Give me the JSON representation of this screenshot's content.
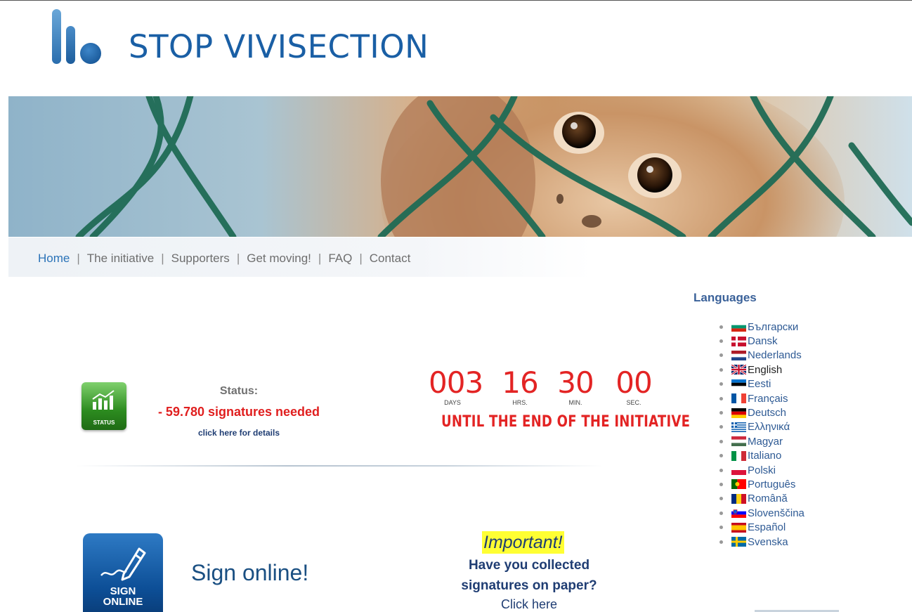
{
  "header": {
    "site_title": "STOP VIVISECTION"
  },
  "nav": {
    "items": [
      {
        "label": "Home",
        "active": true
      },
      {
        "label": "The initiative",
        "active": false
      },
      {
        "label": "Supporters",
        "active": false
      },
      {
        "label": "Get moving!",
        "active": false
      },
      {
        "label": "FAQ",
        "active": false
      },
      {
        "label": "Contact",
        "active": false
      }
    ],
    "separator": "|"
  },
  "status": {
    "icon_label": "STATUS",
    "title": "Status:",
    "needed": "- 59.780 signatures needed",
    "details_link": "click here for details"
  },
  "countdown": {
    "units": [
      {
        "value": "003",
        "label": "DAYS"
      },
      {
        "value": "16",
        "label": "HRS."
      },
      {
        "value": "30",
        "label": "MIN."
      },
      {
        "value": "00",
        "label": "SEC."
      }
    ],
    "caption": "UNTIL THE END OF THE INITIATIVE"
  },
  "sign": {
    "icon_line1": "SIGN",
    "icon_line2": "ONLINE",
    "text": "Sign online!"
  },
  "paper": {
    "important": "Important!",
    "question_line1": "Have you collected",
    "question_line2": "signatures on paper?",
    "link": "Click here"
  },
  "languages": {
    "title": "Languages",
    "items": [
      {
        "label": "Български",
        "flag": "bg"
      },
      {
        "label": "Dansk",
        "flag": "dk"
      },
      {
        "label": "Nederlands",
        "flag": "nl"
      },
      {
        "label": "English",
        "flag": "gb",
        "current": true
      },
      {
        "label": "Eesti",
        "flag": "ee"
      },
      {
        "label": "Français",
        "flag": "fr"
      },
      {
        "label": "Deutsch",
        "flag": "de"
      },
      {
        "label": "Ελληνικά",
        "flag": "gr"
      },
      {
        "label": "Magyar",
        "flag": "hu"
      },
      {
        "label": "Italiano",
        "flag": "it"
      },
      {
        "label": "Polski",
        "flag": "pl"
      },
      {
        "label": "Português",
        "flag": "pt"
      },
      {
        "label": "Română",
        "flag": "ro"
      },
      {
        "label": "Slovenščina",
        "flag": "si"
      },
      {
        "label": "Español",
        "flag": "es"
      },
      {
        "label": "Svenska",
        "flag": "se"
      }
    ]
  },
  "colors": {
    "brand_blue": "#1a5fa5",
    "countdown_red": "#e32424",
    "status_green": "#2c8b1f",
    "highlight_yellow": "#ffff33"
  }
}
